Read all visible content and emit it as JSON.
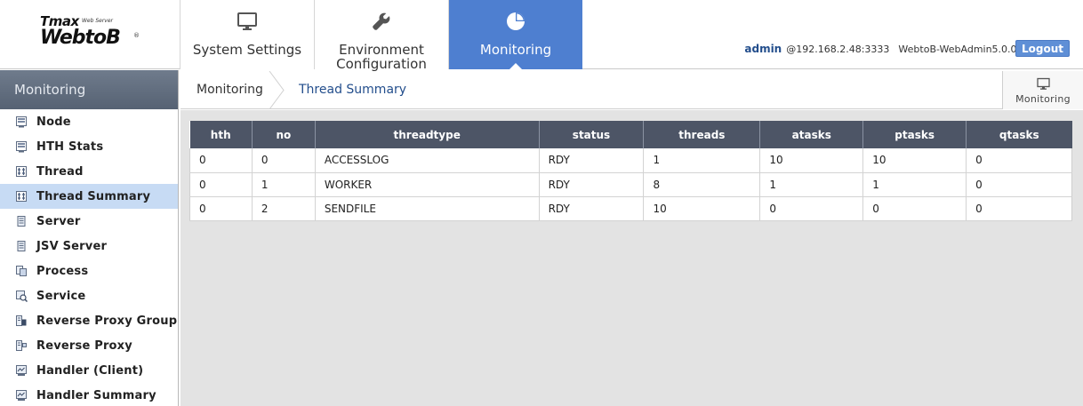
{
  "logo": {
    "brand_small": "Tmax",
    "brand_tag": "Web Server",
    "brand_large": "WebtoB",
    "registered": "®"
  },
  "nav": {
    "tabs": [
      {
        "label": "System Settings",
        "icon": "monitor-icon"
      },
      {
        "label": "Environment Configuration",
        "icon": "wrench-icon"
      },
      {
        "label": "Monitoring",
        "icon": "pie-chart-icon",
        "active": true
      }
    ]
  },
  "user": {
    "name": "admin",
    "host": "@192.168.2.48:3333",
    "version": "WebtoB-WebAdmin5.0.0.1-b8",
    "logout_label": "Logout"
  },
  "sidebar": {
    "title": "Monitoring",
    "items": [
      {
        "label": "Node",
        "icon": "node-icon"
      },
      {
        "label": "HTH Stats",
        "icon": "hth-stats-icon"
      },
      {
        "label": "Thread",
        "icon": "thread-icon"
      },
      {
        "label": "Thread Summary",
        "icon": "thread-summary-icon",
        "active": true
      },
      {
        "label": "Server",
        "icon": "server-icon"
      },
      {
        "label": "JSV Server",
        "icon": "jsv-server-icon"
      },
      {
        "label": "Process",
        "icon": "process-icon"
      },
      {
        "label": "Service",
        "icon": "service-icon"
      },
      {
        "label": "Reverse Proxy Group",
        "icon": "reverse-proxy-group-icon"
      },
      {
        "label": "Reverse Proxy",
        "icon": "reverse-proxy-icon"
      },
      {
        "label": "Handler (Client)",
        "icon": "handler-client-icon"
      },
      {
        "label": "Handler Summary",
        "icon": "handler-summary-icon"
      }
    ]
  },
  "breadcrumb": {
    "root": "Monitoring",
    "current": "Thread Summary"
  },
  "monitoring_button": {
    "label": "Monitoring",
    "icon": "monitor-icon"
  },
  "table": {
    "columns": [
      "hth",
      "no",
      "threadtype",
      "status",
      "threads",
      "atasks",
      "ptasks",
      "qtasks"
    ],
    "rows": [
      [
        "0",
        "0",
        "ACCESSLOG",
        "RDY",
        "1",
        "10",
        "10",
        "0"
      ],
      [
        "0",
        "1",
        "WORKER",
        "RDY",
        "8",
        "1",
        "1",
        "0"
      ],
      [
        "0",
        "2",
        "SENDFILE",
        "RDY",
        "10",
        "0",
        "0",
        "0"
      ]
    ]
  },
  "colors": {
    "accent": "#4e7fd0",
    "header_table": "#4d5566",
    "sidebar_title": "#5d6878",
    "active_item": "#c7dbf4",
    "content_bg": "#e3e3e3"
  }
}
